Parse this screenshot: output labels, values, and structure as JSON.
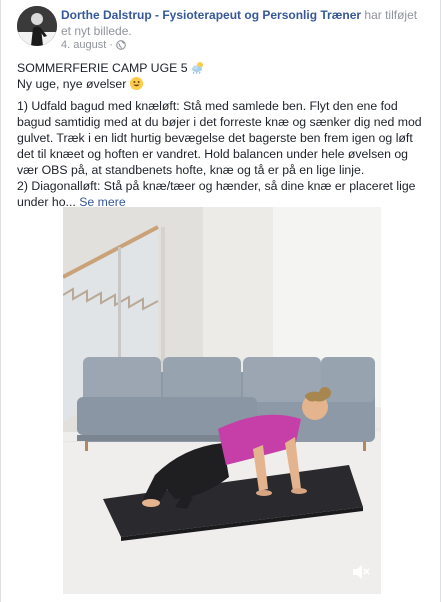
{
  "post": {
    "author": "Dorthe Dalstrup - Fysioterapeut og Personlig Træner",
    "action": "har tilføjet et nyt billede.",
    "date": "4. august",
    "date_separator": "·",
    "privacy_icon": "globe-icon"
  },
  "content": {
    "title": "SOMMERFERIE CAMP UGE 5",
    "title_emoji": "cloud-sun-icon",
    "subtitle": "Ny uge, nye øvelser",
    "subtitle_emoji": "smile-icon",
    "paragraph_1": "1) Udfald bagud med knæløft: Stå med samlede ben. Flyt den ene fod bagud samtidig med at du bøjer i det forreste knæ og sænker dig ned mod gulvet. Træk i en lidt hurtig bevægelse det bagerste ben frem igen og løft det til knæet og hoften er vandret. Hold balancen under hele øvelsen og vær OBS på, at standbenets hofte, knæ og tå er på en lige linje.",
    "paragraph_2": "2) Diagonalløft: Stå på knæ/tæer og hænder, så dine knæ er placeret lige under ho...",
    "see_more": "Se mere"
  },
  "media": {
    "type": "video",
    "mute_icon": "muted-speaker-icon"
  },
  "colors": {
    "link": "#365899",
    "meta": "#90949c",
    "text": "#1d2129"
  }
}
